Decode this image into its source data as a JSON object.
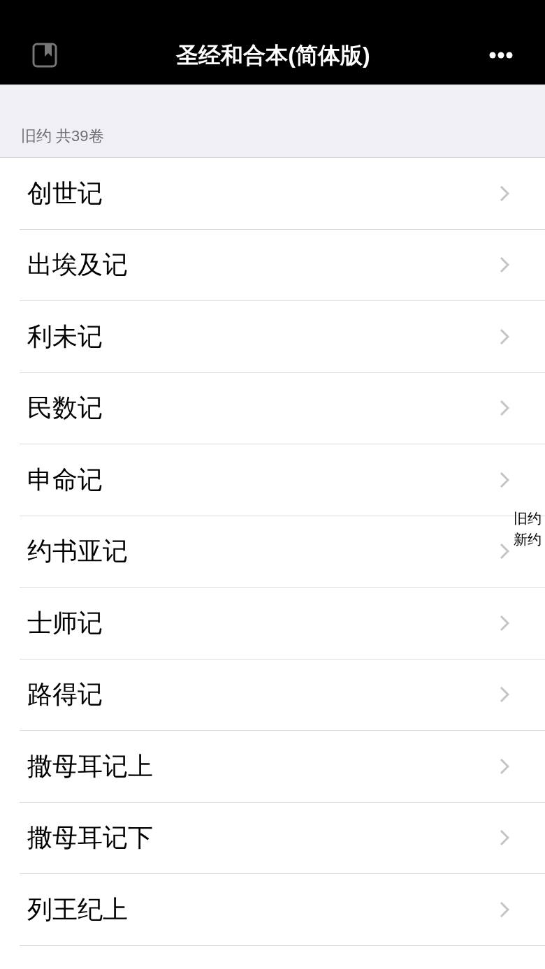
{
  "header": {
    "title": "圣经和合本(简体版)"
  },
  "section": {
    "label": "旧约 共39卷"
  },
  "books": [
    "创世记",
    "出埃及记",
    "利未记",
    "民数记",
    "申命记",
    "约书亚记",
    "士师记",
    "路得记",
    "撒母耳记上",
    "撒母耳记下",
    "列王纪上"
  ],
  "index": [
    "旧约",
    "新约"
  ]
}
